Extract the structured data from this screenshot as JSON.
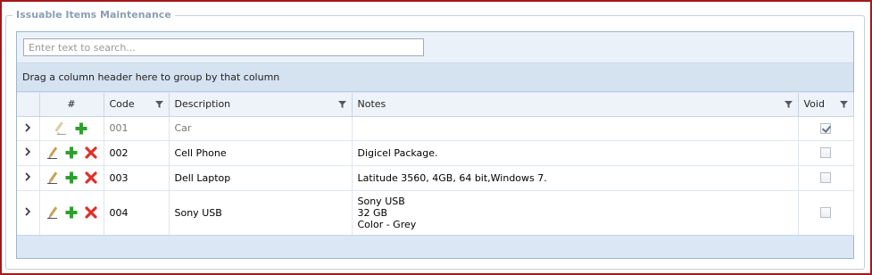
{
  "section": {
    "title": "Issuable Items Maintenance"
  },
  "search": {
    "placeholder": "Enter text to search..."
  },
  "group_panel": {
    "text": "Drag a column header here to group by that column"
  },
  "columns": {
    "number": "#",
    "code": "Code",
    "description": "Description",
    "notes": "Notes",
    "void": "Void"
  },
  "rows": [
    {
      "code": "001",
      "description": "Car",
      "notes": [
        ""
      ],
      "void": true,
      "has_delete": false
    },
    {
      "code": "002",
      "description": "Cell Phone",
      "notes": [
        "Digicel Package."
      ],
      "void": false,
      "has_delete": true
    },
    {
      "code": "003",
      "description": "Dell Laptop",
      "notes": [
        "Latitude 3560, 4GB, 64 bit,Windows 7."
      ],
      "void": false,
      "has_delete": true
    },
    {
      "code": "004",
      "description": "Sony USB",
      "notes": [
        "Sony USB",
        "32 GB",
        "Color - Grey"
      ],
      "void": false,
      "has_delete": true
    }
  ],
  "icons": {
    "expand": "chevron-right-icon",
    "edit": "pencil-icon",
    "add": "plus-icon",
    "delete": "x-icon",
    "filter": "filter-icon"
  },
  "colors": {
    "border_accent": "#a31a1a",
    "legend_text": "#8a9fb5",
    "grid_border": "#9eb6ce",
    "group_panel_bg": "#d5e2f0",
    "add_green": "#2ea02e",
    "delete_red": "#e0302a"
  }
}
